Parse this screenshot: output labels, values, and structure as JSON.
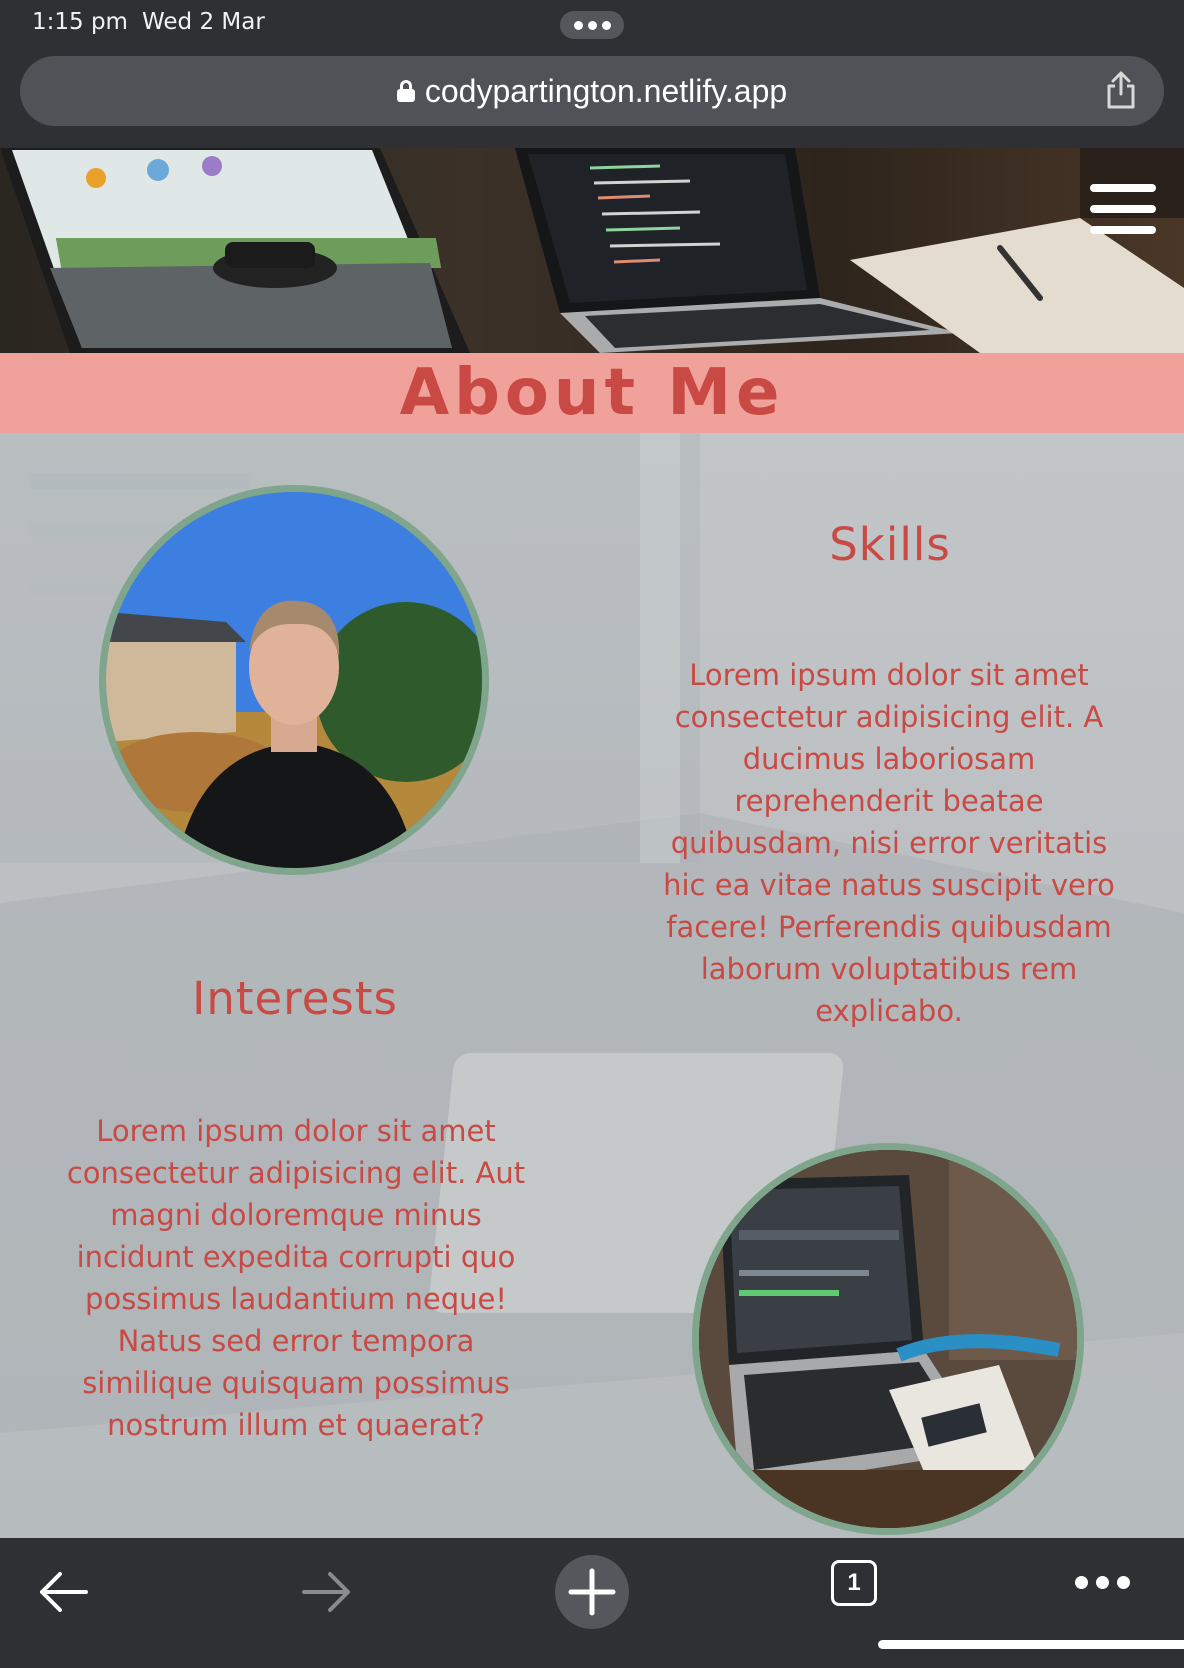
{
  "status_bar": {
    "time": "1:15 pm",
    "date": "Wed 2 Mar"
  },
  "browser": {
    "url": "codypartington.netlify.app",
    "tab_count": "1"
  },
  "icons": {
    "lock": "lock-icon",
    "share": "share-icon",
    "menu": "hamburger-icon",
    "back": "back-arrow-icon",
    "forward": "forward-arrow-icon",
    "new_tab": "plus-icon",
    "tabs": "tabs-icon",
    "more": "more-dots-icon"
  },
  "page": {
    "about_title": "About Me",
    "skills": {
      "heading": "Skills",
      "body": "Lorem ipsum dolor sit amet consectetur adipisicing elit. A ducimus laboriosam reprehenderit beatae quibusdam, nisi error veritatis hic ea vitae natus suscipit vero facere! Perferendis quibusdam laborum voluptatibus rem explicabo."
    },
    "interests": {
      "heading": "Interests",
      "body": "Lorem ipsum dolor sit amet consectetur adipisicing elit. Aut magni doloremque minus incidunt expedita corrupti quo possimus laudantium neque! Natus sed error tempora similique quisquam possimus nostrum illum et quaerat?"
    }
  },
  "colors": {
    "accent_text": "#c94a44",
    "banner_bg": "#efa19a",
    "photo_border": "#7fa58c",
    "chrome_bg": "#2f3034"
  }
}
